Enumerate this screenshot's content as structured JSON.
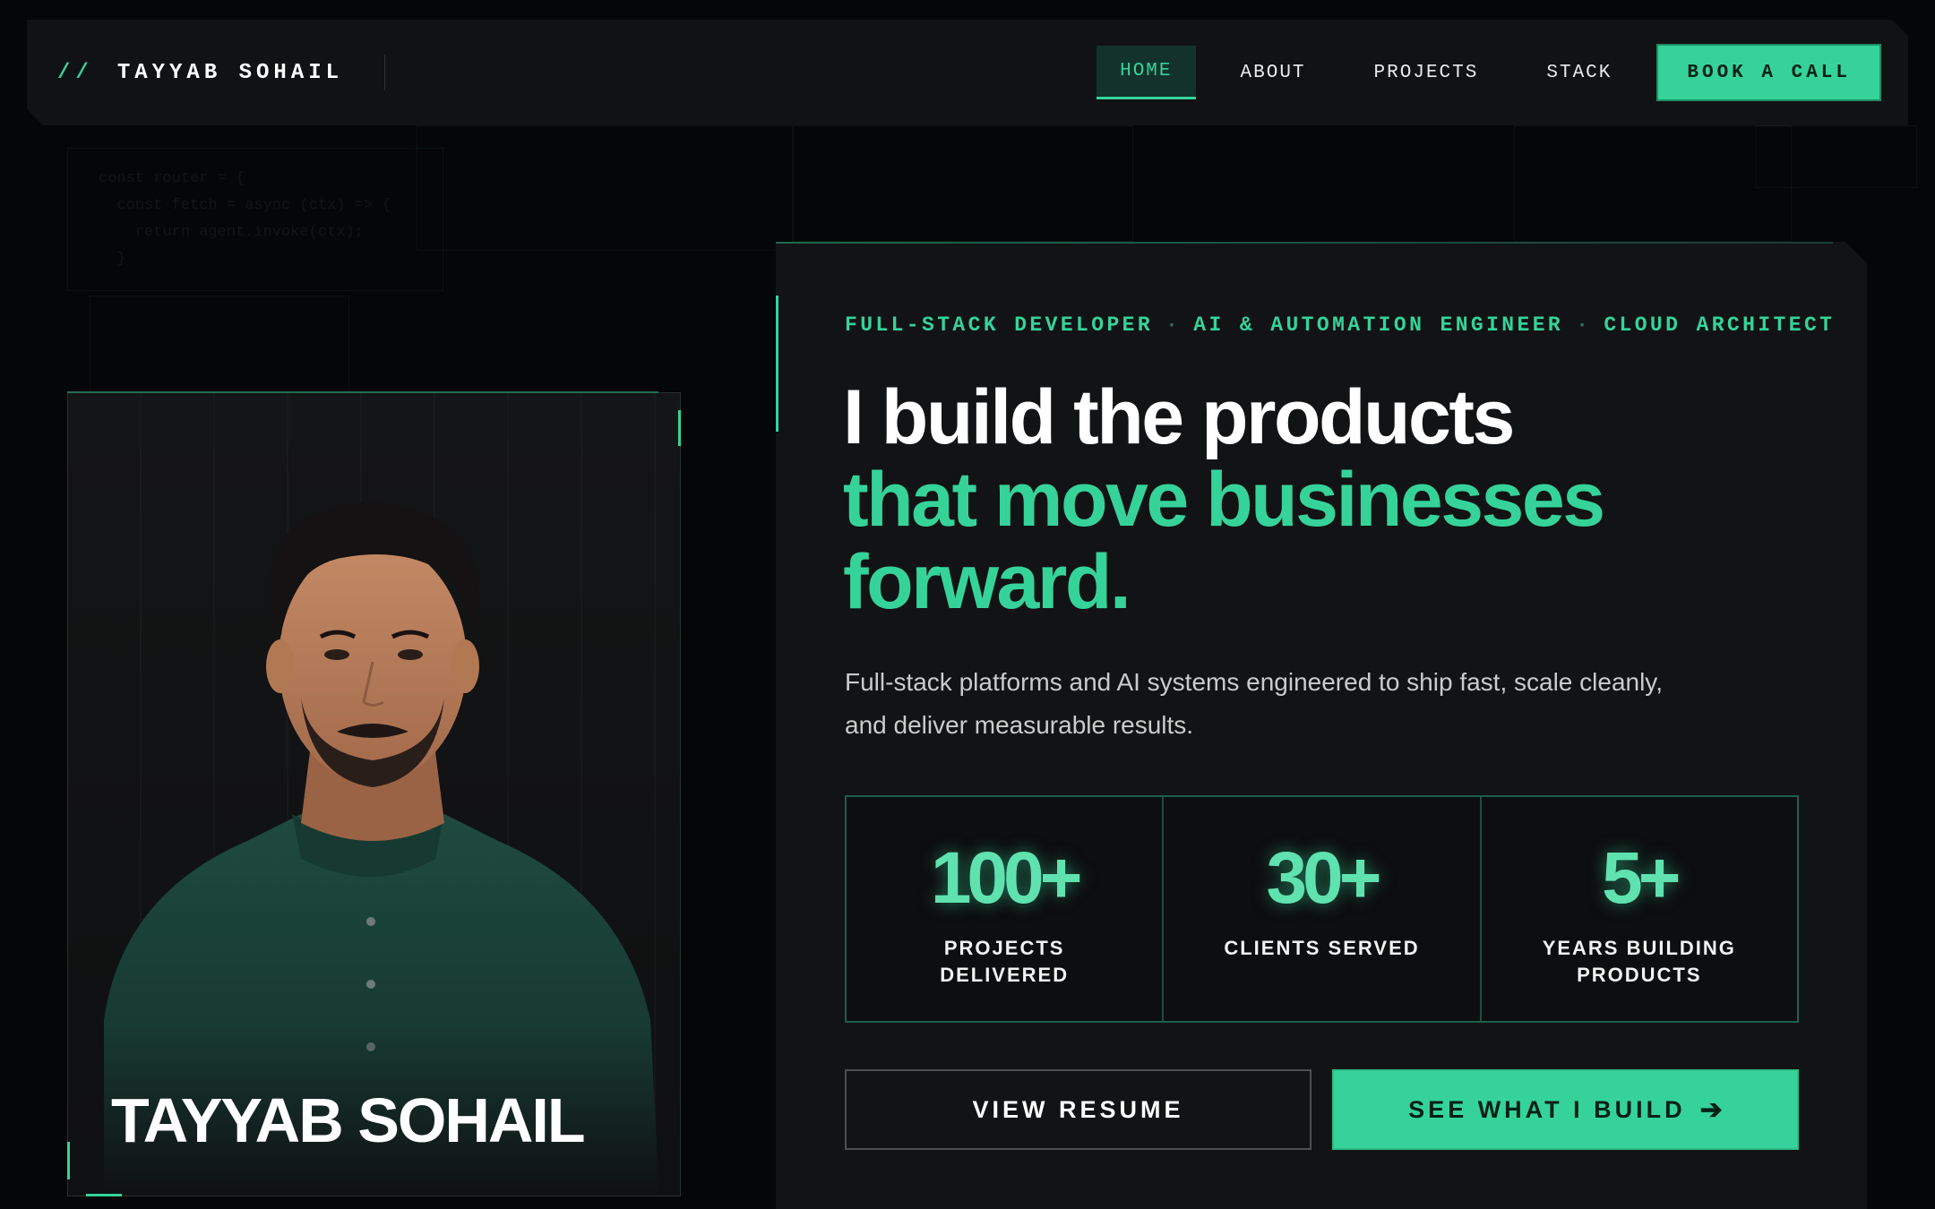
{
  "nav": {
    "brand_slashes": "//",
    "brand_name": "TAYYAB SOHAIL",
    "links": [
      "HOME",
      "ABOUT",
      "PROJECTS",
      "STACK"
    ],
    "active_link": "HOME",
    "cta": "BOOK A CALL"
  },
  "portrait": {
    "name": "TAYYAB SOHAIL"
  },
  "hero": {
    "roles": [
      "FULL-STACK DEVELOPER",
      "AI & AUTOMATION ENGINEER",
      "CLOUD ARCHITECT"
    ],
    "role_separator": "·",
    "headline_line1": "I build the products",
    "headline_line2": "that move businesses",
    "headline_line3": "forward.",
    "subtitle": "Full-stack platforms and AI systems engineered to ship fast, scale cleanly, and deliver measurable results."
  },
  "stats": [
    {
      "value": "100+",
      "label": "PROJECTS DELIVERED"
    },
    {
      "value": "30+",
      "label": "CLIENTS SERVED"
    },
    {
      "value": "5+",
      "label": "YEARS BUILDING PRODUCTS"
    }
  ],
  "buttons": {
    "resume": "VIEW RESUME",
    "work": "SEE WHAT I BUILD",
    "work_icon": "arrow-right-icon"
  },
  "colors": {
    "accent": "#35d39a",
    "background": "#050607",
    "card": "#121314"
  }
}
